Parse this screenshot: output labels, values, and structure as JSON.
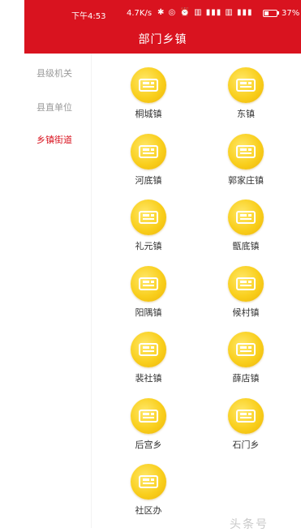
{
  "status_bar": {
    "time": "下午4:53",
    "net_speed": "4.7K/s",
    "icons_text": "✱ ◎ ⏰ ▥ ▮▮▮ ▥ ▮▮▮",
    "battery_text": "37%",
    "battery_level": 0.37
  },
  "header": {
    "title": "部门乡镇"
  },
  "sidebar": {
    "items": [
      {
        "label": "县级机关",
        "active": false
      },
      {
        "label": "县直单位",
        "active": false
      },
      {
        "label": "乡镇街道",
        "active": true
      }
    ]
  },
  "towns": [
    {
      "label": "桐城镇"
    },
    {
      "label": "东镇"
    },
    {
      "label": "河底镇"
    },
    {
      "label": "郭家庄镇"
    },
    {
      "label": "礼元镇"
    },
    {
      "label": "甑底镇"
    },
    {
      "label": "阳隅镇"
    },
    {
      "label": "候村镇"
    },
    {
      "label": "裴社镇"
    },
    {
      "label": "薛店镇"
    },
    {
      "label": "后宫乡"
    },
    {
      "label": "石门乡"
    },
    {
      "label": "社区办"
    }
  ],
  "watermark": "头条号",
  "colors": {
    "brand_red": "#d9131f",
    "icon_gold": "#f9cf1d"
  },
  "icon_name": "building-icon"
}
